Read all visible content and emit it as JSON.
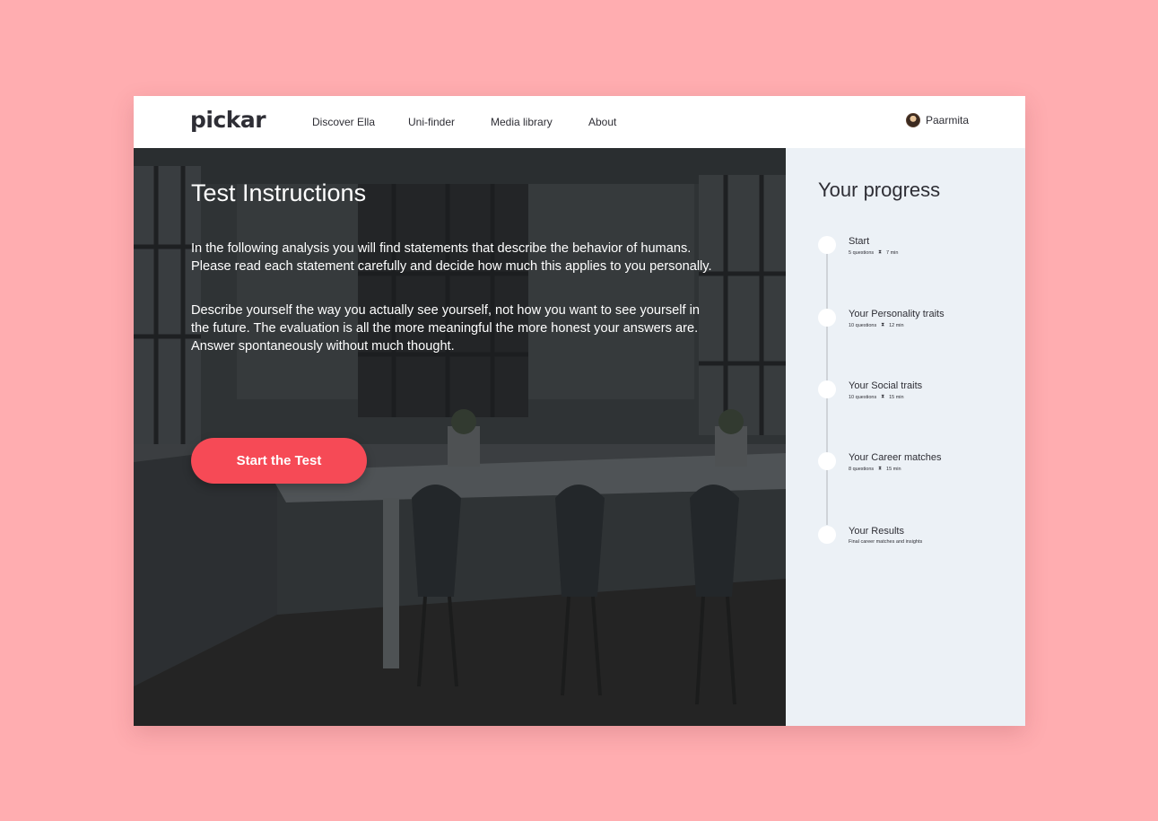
{
  "brand": {
    "logo": "pickar"
  },
  "nav": {
    "links": [
      "Discover Ella",
      "Uni-finder",
      "Media library",
      "About"
    ],
    "user_name": "Paarmita"
  },
  "hero": {
    "title": "Test Instructions",
    "paragraph_1": "In the following analysis you will find statements that describe the behavior of humans. Please read each statement carefully and decide how much this applies to you personally.",
    "paragraph_2": "Describe yourself the way you actually see yourself, not how you want to see yourself in the future. The evaluation is all the more meaningful the more honest your answers are. Answer spontaneously without much thought.",
    "cta_label": "Start the Test"
  },
  "progress": {
    "title": "Your progress",
    "steps": [
      {
        "title": "Start",
        "questions": "5 questions",
        "time": "7 min"
      },
      {
        "title": "Your Personality traits",
        "questions": "10 questions",
        "time": "12 min"
      },
      {
        "title": "Your Social traits",
        "questions": "10 questions",
        "time": "15 min"
      },
      {
        "title": "Your Career matches",
        "questions": "8 questions",
        "time": "15 min"
      },
      {
        "title": "Your Results",
        "description": "Final career matches and insights"
      }
    ]
  },
  "colors": {
    "page_background": "#ffadb0",
    "accent": "#f64a56",
    "sidebar_background": "#ecf1f6",
    "text_dark": "#2e2e35"
  },
  "icons": {
    "time": "hourglass-icon"
  }
}
